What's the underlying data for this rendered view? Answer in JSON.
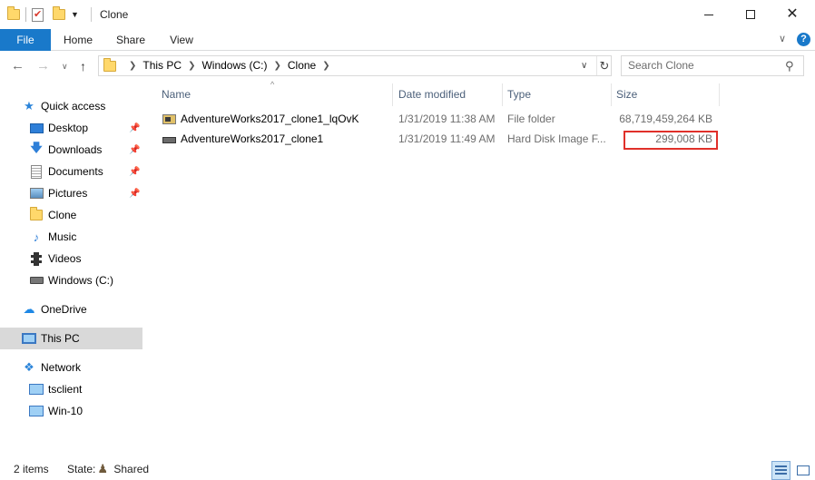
{
  "window": {
    "title": "Clone",
    "minimize_glyph": "",
    "close_glyph": "✕"
  },
  "ribbon": {
    "tabs": [
      {
        "label": "File"
      },
      {
        "label": "Home"
      },
      {
        "label": "Share"
      },
      {
        "label": "View"
      }
    ],
    "help_glyph": "?"
  },
  "address": {
    "crumbs": [
      "This PC",
      "Windows (C:)",
      "Clone"
    ]
  },
  "search": {
    "placeholder": "Search Clone"
  },
  "navigation": {
    "quick_access": "Quick access",
    "items": [
      {
        "label": "Desktop",
        "pinned": true
      },
      {
        "label": "Downloads",
        "pinned": true
      },
      {
        "label": "Documents",
        "pinned": true
      },
      {
        "label": "Pictures",
        "pinned": true
      },
      {
        "label": "Clone",
        "pinned": false
      },
      {
        "label": "Music",
        "pinned": false
      },
      {
        "label": "Videos",
        "pinned": false
      },
      {
        "label": "Windows (C:)",
        "pinned": false
      }
    ],
    "onedrive": "OneDrive",
    "this_pc": "This PC",
    "network": "Network",
    "network_items": [
      "tsclient",
      "Win-10"
    ]
  },
  "columns": {
    "name": "Name",
    "date": "Date modified",
    "type": "Type",
    "size": "Size"
  },
  "files": [
    {
      "name": "AdventureWorks2017_clone1_lqOvK",
      "date": "1/31/2019 11:38 AM",
      "type": "File folder",
      "size": "68,719,459,264 KB"
    },
    {
      "name": "AdventureWorks2017_clone1",
      "date": "1/31/2019 11:49 AM",
      "type": "Hard Disk Image F...",
      "size": "299,008 KB"
    }
  ],
  "status": {
    "count": "2 items",
    "state_label": "State:",
    "state_value": "Shared"
  },
  "colors": {
    "accent": "#1979ca",
    "selection": "#d9d9d9",
    "highlight_box": "#e0302a",
    "column_header": "#4c607a"
  }
}
